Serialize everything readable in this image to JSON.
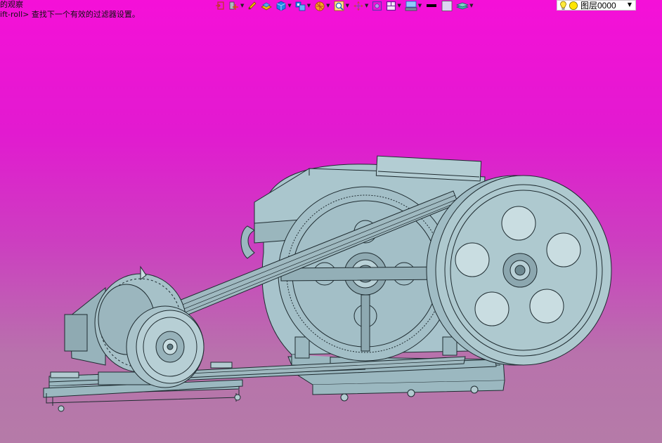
{
  "prompt": {
    "line1": "的观察",
    "line2": "ift-roll> 查找下一个有效的过滤器设置。"
  },
  "toolbar": {
    "buttons": [
      {
        "name": "ucs-icon",
        "has_arrow": false
      },
      {
        "name": "ucs-origin-icon",
        "has_arrow": true
      },
      {
        "name": "pencil-icon",
        "has_arrow": false
      },
      {
        "name": "surface-icon",
        "has_arrow": false
      },
      {
        "name": "solid-box-icon",
        "has_arrow": true
      },
      {
        "name": "mesh-icon",
        "has_arrow": true
      },
      {
        "name": "render-ball-icon",
        "has_arrow": true
      },
      {
        "name": "zoom-icon",
        "has_arrow": true
      },
      {
        "name": "pan-icon",
        "has_arrow": true
      },
      {
        "name": "orbit-icon",
        "has_arrow": false
      },
      {
        "name": "viewport-icon",
        "has_arrow": true
      },
      {
        "name": "visual-style-icon",
        "has_arrow": true
      },
      {
        "name": "lineweight-icon",
        "has_arrow": false
      },
      {
        "name": "color-icon",
        "has_arrow": false
      },
      {
        "name": "layer-stack-icon",
        "has_arrow": true
      }
    ],
    "colors": {
      "primary": "#1565c0",
      "accent": "#f2b705",
      "light": "#5aa9e6"
    }
  },
  "layer": {
    "current": "图层0000",
    "bulb_icon": "lightbulb-icon",
    "color_icon": "layer-color-circle-icon"
  },
  "model": {
    "fill": "#9bb8c0",
    "stroke": "#1e2b30",
    "subject": "belt-driven-crusher-assembly"
  }
}
